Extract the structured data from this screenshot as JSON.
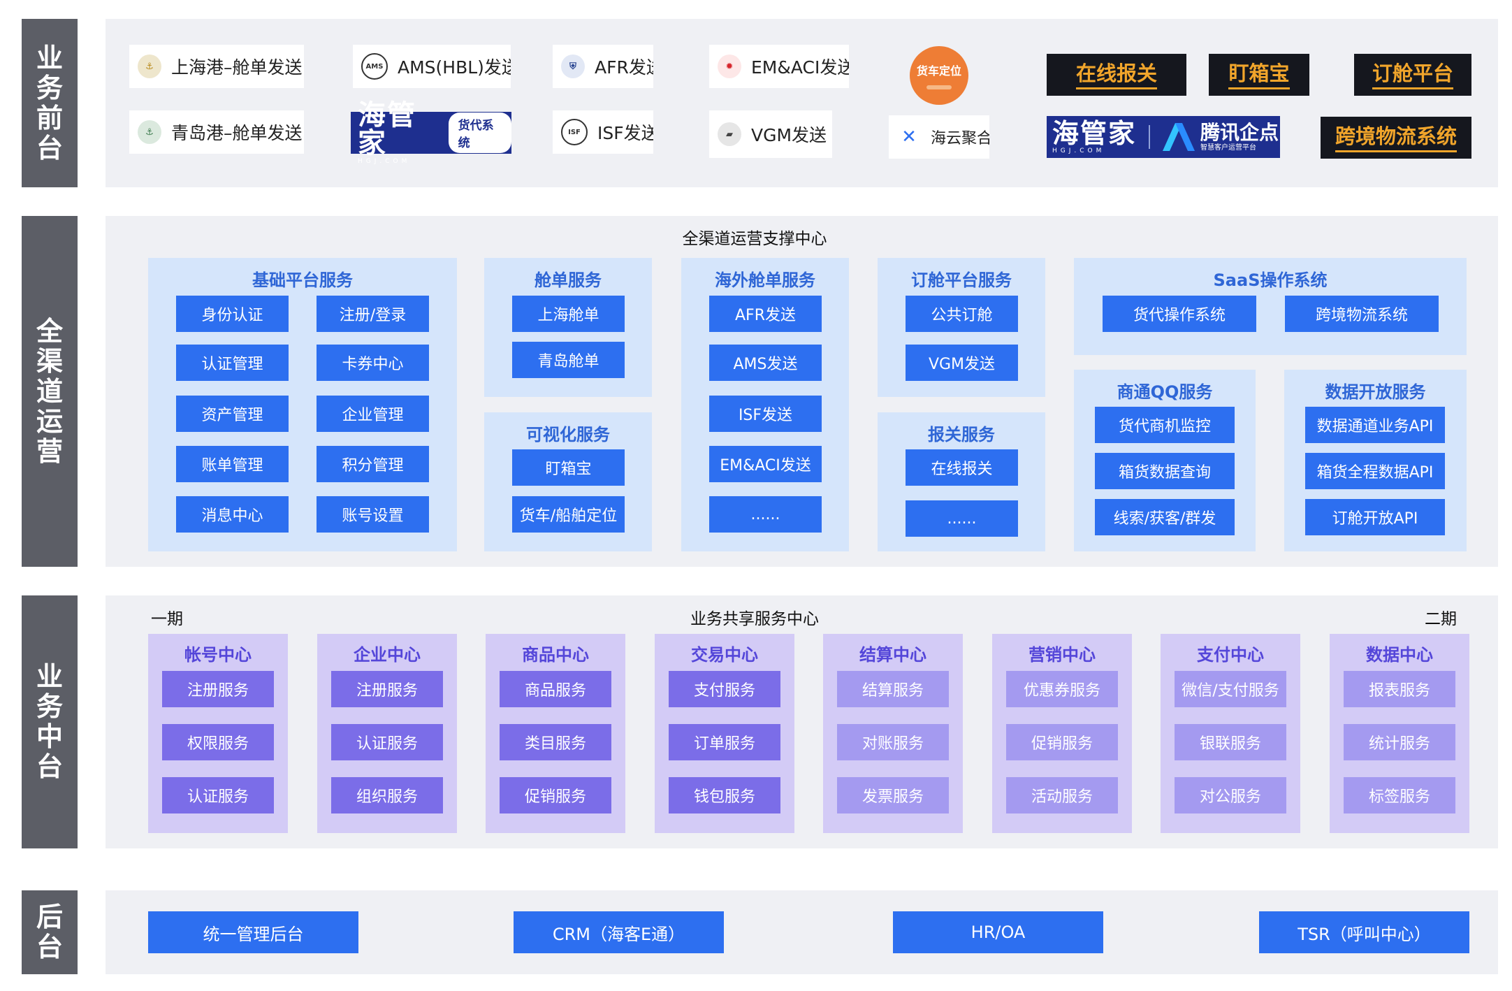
{
  "layers": {
    "front": "业务前台",
    "omni": "全渠道运营",
    "middle": "业务中台",
    "back": "后台"
  },
  "front": {
    "tiles": [
      "上海港–舱单发送",
      "AMS(HBL)发送",
      "AFR发送",
      "EM&ACI发送",
      "青岛港–舱单发送",
      "ISF发送",
      "VGM发送",
      "海云聚合"
    ],
    "icons": {
      "ams": "AMS",
      "isf": "ISF"
    },
    "truck_badge": "货车定位",
    "logo_hgj": "海管家",
    "logo_hgj_sub": "HGJ.COM",
    "logo_hgj_pill": "货代系统",
    "logo_tencent": "腾讯企点",
    "logo_tencent_sub": "智慧客户运营平台",
    "dark": [
      "在线报关",
      "盯箱宝",
      "订舱平台",
      "跨境物流系统"
    ]
  },
  "omni": {
    "title": "全渠道运营支撑中心",
    "base": {
      "title": "基础平台服务",
      "items": [
        "身份认证",
        "注册/登录",
        "认证管理",
        "卡券中心",
        "资产管理",
        "企业管理",
        "账单管理",
        "积分管理",
        "消息中心",
        "账号设置"
      ]
    },
    "cabin": {
      "title": "舱单服务",
      "items": [
        "上海舱单",
        "青岛舱单"
      ]
    },
    "visual": {
      "title": "可视化服务",
      "items": [
        "盯箱宝",
        "货车/船舶定位"
      ]
    },
    "overseas": {
      "title": "海外舱单服务",
      "items": [
        "AFR发送",
        "AMS发送",
        "ISF发送",
        "EM&ACI发送",
        "......"
      ]
    },
    "booking": {
      "title": "订舱平台服务",
      "items": [
        "公共订舱",
        "VGM发送"
      ]
    },
    "customs": {
      "title": "报关服务",
      "items": [
        "在线报关",
        "......"
      ]
    },
    "saas": {
      "title": "SaaS操作系统",
      "items": [
        "货代操作系统",
        "跨境物流系统"
      ]
    },
    "qq": {
      "title": "商通QQ服务",
      "items": [
        "货代商机监控",
        "箱货数据查询",
        "线索/获客/群发"
      ]
    },
    "open": {
      "title": "数据开放服务",
      "items": [
        "数据通道业务API",
        "箱货全程数据API",
        "订舱开放API"
      ]
    }
  },
  "middle": {
    "title": "业务共享服务中心",
    "phase1": "一期",
    "phase2": "二期",
    "centers": [
      {
        "title": "帐号中心",
        "items": [
          "注册服务",
          "权限服务",
          "认证服务"
        ]
      },
      {
        "title": "企业中心",
        "items": [
          "注册服务",
          "认证服务",
          "组织服务"
        ]
      },
      {
        "title": "商品中心",
        "items": [
          "商品服务",
          "类目服务",
          "促销服务"
        ]
      },
      {
        "title": "交易中心",
        "items": [
          "支付服务",
          "订单服务",
          "钱包服务"
        ]
      },
      {
        "title": "结算中心",
        "items": [
          "结算服务",
          "对账服务",
          "发票服务"
        ]
      },
      {
        "title": "营销中心",
        "items": [
          "优惠券服务",
          "促销服务",
          "活动服务"
        ]
      },
      {
        "title": "支付中心",
        "items": [
          "微信/支付服务",
          "银联服务",
          "对公服务"
        ]
      },
      {
        "title": "数据中心",
        "items": [
          "报表服务",
          "统计服务",
          "标签服务"
        ]
      }
    ]
  },
  "back": {
    "items": [
      "统一管理后台",
      "CRM（海客E通）",
      "HR/OA",
      "TSR（呼叫中心）"
    ]
  },
  "colors": {
    "primary": "#2d6ff0",
    "light_blue": "#d5e5fb",
    "purple_dark": "#7b6de8",
    "purple_light": "#a49af0",
    "purple_bg": "#d3cbf6",
    "panel": "#eff0f4",
    "label": "#5c5e66",
    "gold": "#f1a52b"
  }
}
